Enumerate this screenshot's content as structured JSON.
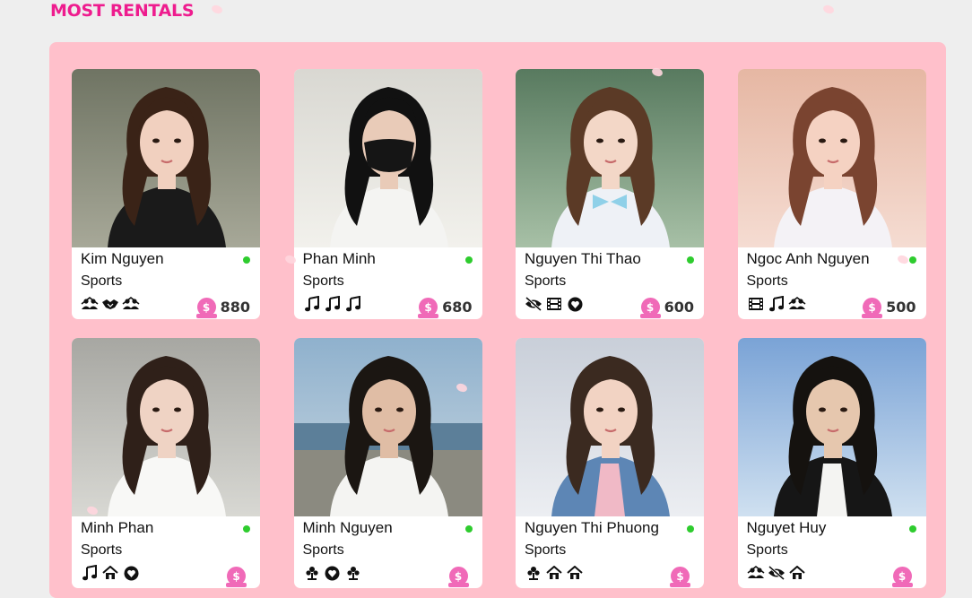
{
  "section": {
    "title": "MOST RENTALS"
  },
  "cards": [
    {
      "name": "Kim Nguyen",
      "category": "Sports",
      "price": "880",
      "hobbies": [
        "group-icon",
        "handshake-icon",
        "group-icon"
      ],
      "status": "online",
      "photo": "portrait-woman-dark-dress"
    },
    {
      "name": "Phan Minh",
      "category": "Sports",
      "price": "680",
      "hobbies": [
        "music-icon",
        "music-icon",
        "music-icon"
      ],
      "status": "online",
      "photo": "portrait-man-black-mask"
    },
    {
      "name": "Nguyen Thi Thao",
      "category": "Sports",
      "price": "600",
      "hobbies": [
        "no-eye-icon",
        "film-icon",
        "heart-icon"
      ],
      "status": "online",
      "photo": "portrait-woman-school-uniform"
    },
    {
      "name": "Ngoc Anh Nguyen",
      "category": "Sports",
      "price": "500",
      "hobbies": [
        "film-icon",
        "music-icon",
        "group-icon"
      ],
      "status": "online",
      "photo": "portrait-woman-floral-top"
    },
    {
      "name": "Minh Phan",
      "category": "Sports",
      "price": "",
      "hobbies": [
        "music-icon",
        "home-icon",
        "heart-icon"
      ],
      "status": "online",
      "photo": "portrait-woman-white-top"
    },
    {
      "name": "Minh Nguyen",
      "category": "Sports",
      "price": "",
      "hobbies": [
        "flower-icon",
        "heart-icon",
        "flower-icon"
      ],
      "status": "online",
      "photo": "portrait-man-by-sea"
    },
    {
      "name": "Nguyen Thi Phuong",
      "category": "Sports",
      "price": "",
      "hobbies": [
        "flower-icon",
        "home-icon",
        "home-icon"
      ],
      "status": "online",
      "photo": "portrait-woman-denim-jacket"
    },
    {
      "name": "Nguyet Huy",
      "category": "Sports",
      "price": "",
      "hobbies": [
        "group-icon",
        "no-eye-icon",
        "home-icon"
      ],
      "status": "online",
      "photo": "portrait-man-black-blazer"
    }
  ],
  "colors": {
    "accent": "#ee1c8e",
    "panel": "#ffc0cb",
    "online": "#2ecc2e",
    "coin": "#f06ab8"
  }
}
